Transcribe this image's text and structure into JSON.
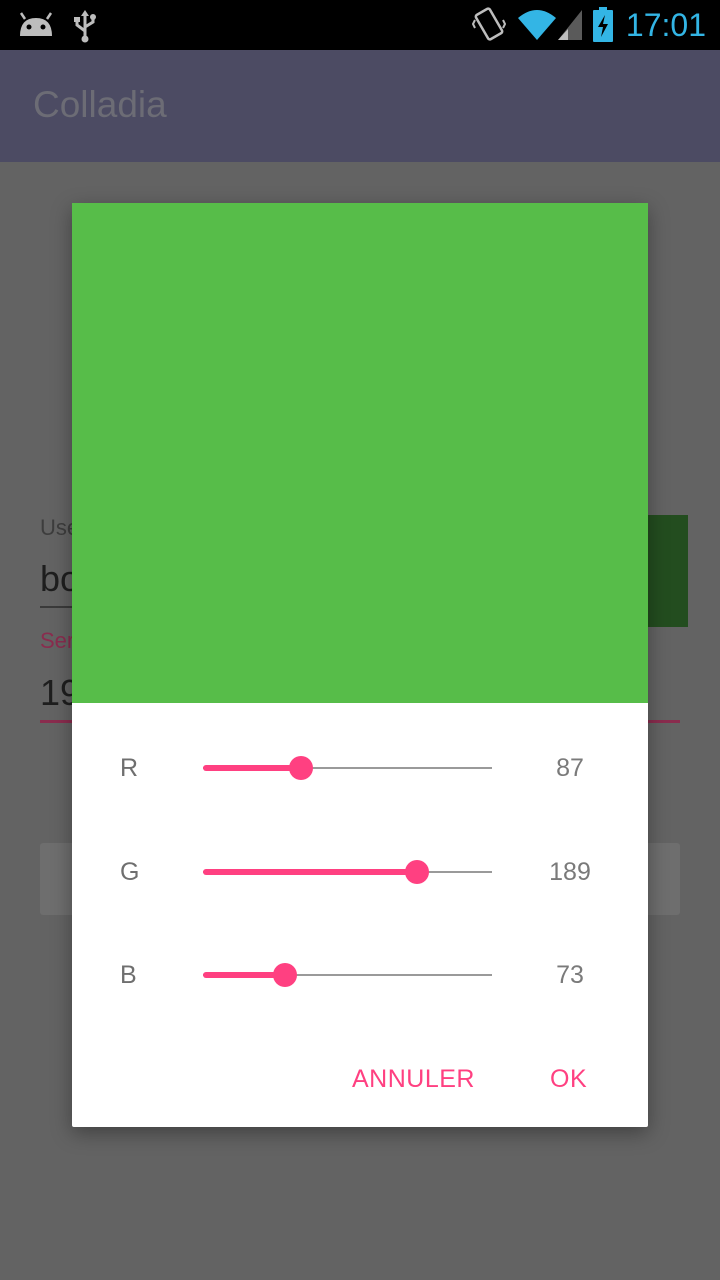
{
  "status_bar": {
    "time": "17:01",
    "icons_left": [
      "android-icon",
      "usb-icon"
    ],
    "icons_right": [
      "vibrate-icon",
      "wifi-icon",
      "signal-icon",
      "battery-charging-icon"
    ],
    "time_color": "#33b5e5"
  },
  "app_bar": {
    "title": "Colladia",
    "color": "#4c4b63"
  },
  "background_form": {
    "user_label": "Use",
    "user_value": "bo",
    "server_label": "Ser",
    "server_value": "19"
  },
  "color_dialog": {
    "preview_color": "#57bd49",
    "accent_color": "#ff4081",
    "sliders": [
      {
        "label": "R",
        "value": "87",
        "max": 255
      },
      {
        "label": "G",
        "value": "189",
        "max": 255
      },
      {
        "label": "B",
        "value": "73",
        "max": 255
      }
    ],
    "cancel_label": "ANNULER",
    "ok_label": "OK"
  }
}
